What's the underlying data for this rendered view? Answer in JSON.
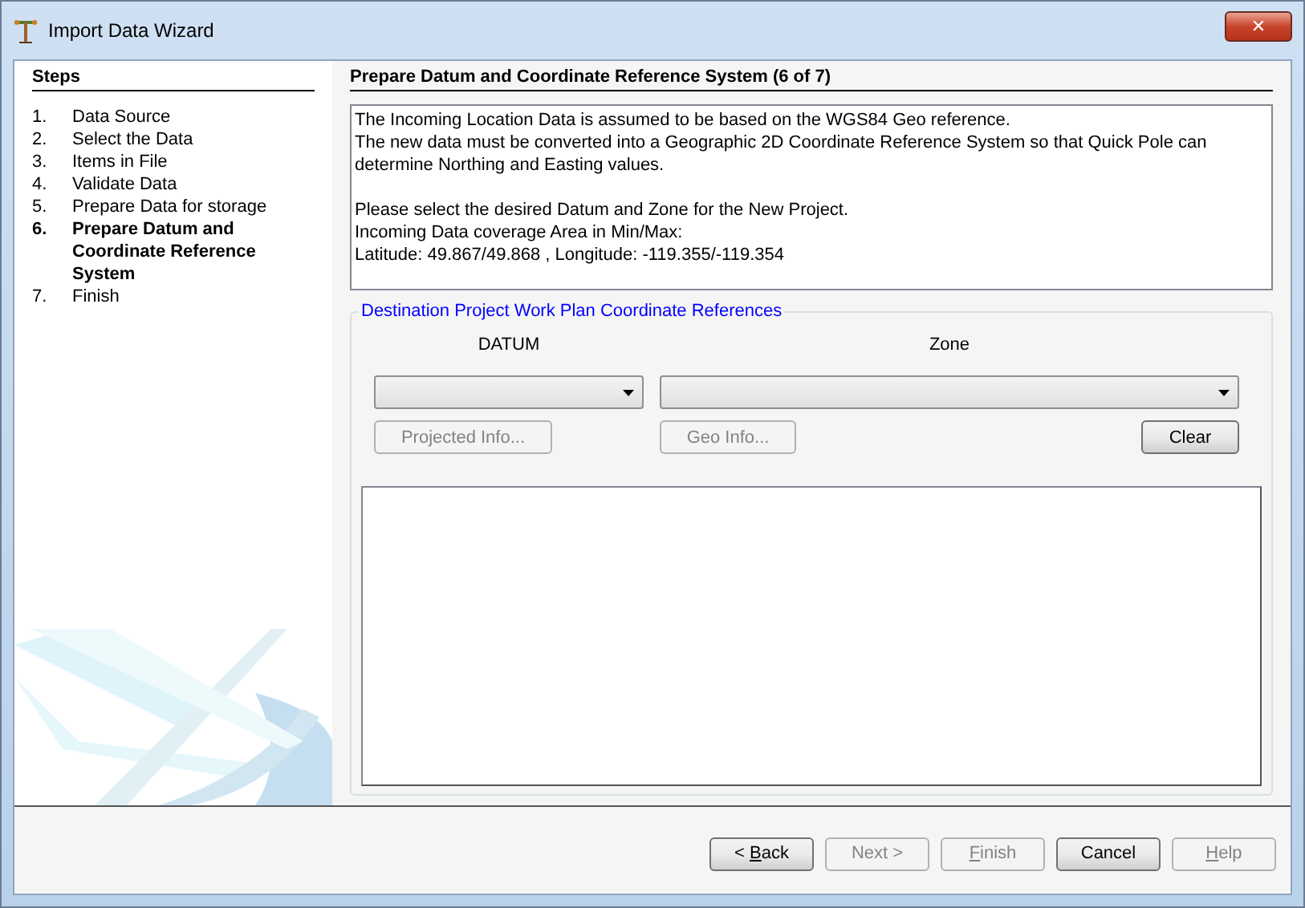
{
  "window": {
    "title": "Import Data Wizard",
    "close": "✕"
  },
  "steps": {
    "title": "Steps",
    "items": [
      {
        "number": "1.",
        "label": "Data Source",
        "selected": false
      },
      {
        "number": "2.",
        "label": "Select the Data",
        "selected": false
      },
      {
        "number": "3.",
        "label": "Items in File",
        "selected": false
      },
      {
        "number": "4.",
        "label": "Validate Data",
        "selected": false
      },
      {
        "number": "5.",
        "label": "Prepare Data for storage",
        "selected": false
      },
      {
        "number": "6.",
        "label": "Prepare Datum and Coordinate Reference System",
        "selected": true
      },
      {
        "number": "7.",
        "label": "Finish",
        "selected": false
      }
    ]
  },
  "page": {
    "title": "Prepare Datum and Coordinate Reference System (6 of 7)",
    "info_paragraphs": [
      [
        "The Incoming Location Data is assumed to be based on the WGS84 Geo reference.",
        "The new data must be converted into a Geographic 2D Coordinate Reference System so that Quick Pole can determine Northing and Easting values."
      ],
      [
        "Please select the desired Datum and Zone for the New Project.",
        "Incoming Data coverage Area in Min/Max:",
        "Latitude: 49.867/49.868 , Longitude: -119.355/-119.354"
      ]
    ],
    "group": {
      "title": "Destination Project Work Plan Coordinate References",
      "datum_label": "DATUM",
      "zone_label": "Zone",
      "buttons": [
        {
          "label": "Projected Info...",
          "disabled": true
        },
        {
          "label": "Geo Info...",
          "disabled": true
        },
        {
          "label": "Clear",
          "disabled": false
        }
      ]
    }
  },
  "footer": {
    "buttons": [
      {
        "before": "< ",
        "key": "B",
        "after": "ack",
        "disabled": false
      },
      {
        "before": "Next >",
        "disabled": true
      },
      {
        "key": "F",
        "after": "inish",
        "disabled": true
      },
      {
        "before": "Cancel",
        "disabled": false
      },
      {
        "key": "H",
        "after": "elp",
        "disabled": true
      }
    ]
  }
}
